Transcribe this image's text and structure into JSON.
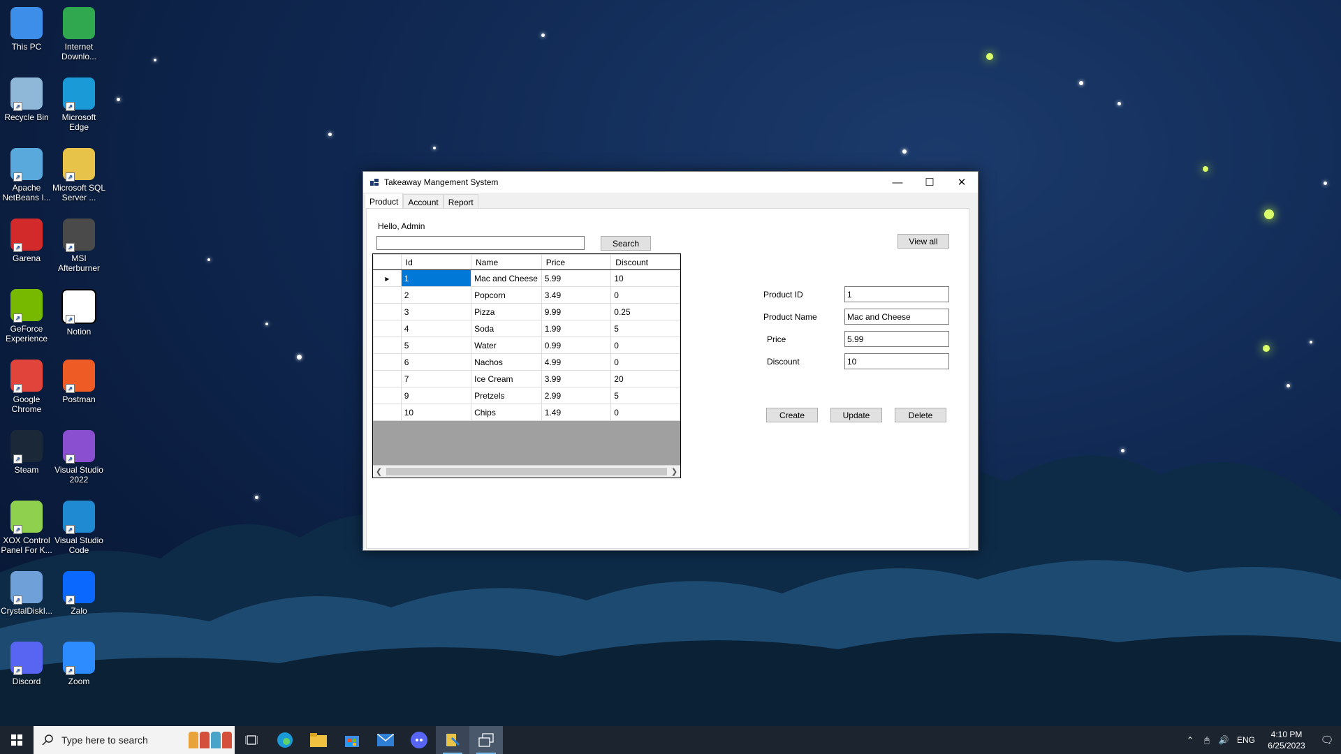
{
  "desktop": {
    "icons": [
      {
        "label": "This PC",
        "name": "this-pc-icon",
        "color": "#3d8ee8"
      },
      {
        "label": "Internet Downlo...",
        "name": "internet-download-manager-icon",
        "color": "#2fa84f"
      },
      {
        "label": "Recycle Bin",
        "name": "recycle-bin-icon",
        "color": "#8eb7d8"
      },
      {
        "label": "Microsoft Edge",
        "name": "edge-icon",
        "color": "#1a9bd7"
      },
      {
        "label": "Apache NetBeans I...",
        "name": "netbeans-icon",
        "color": "#5aa9dd"
      },
      {
        "label": "Microsoft SQL Server ...",
        "name": "sql-server-icon",
        "color": "#e8c34a"
      },
      {
        "label": "Garena",
        "name": "garena-icon",
        "color": "#d22a2a"
      },
      {
        "label": "MSI Afterburner",
        "name": "msi-afterburner-icon",
        "color": "#4a4a4a"
      },
      {
        "label": "GeForce Experience",
        "name": "geforce-icon",
        "color": "#76b900"
      },
      {
        "label": "Notion",
        "name": "notion-icon",
        "color": "#ffffff"
      },
      {
        "label": "Google Chrome",
        "name": "chrome-icon",
        "color": "#e0443a"
      },
      {
        "label": "Postman",
        "name": "postman-icon",
        "color": "#ef5b25"
      },
      {
        "label": "Steam",
        "name": "steam-icon",
        "color": "#1b2838"
      },
      {
        "label": "Visual Studio 2022",
        "name": "visual-studio-icon",
        "color": "#8a4fd0"
      },
      {
        "label": "XOX Control Panel For K...",
        "name": "xox-control-panel-icon",
        "color": "#8fd14f"
      },
      {
        "label": "Visual Studio Code",
        "name": "vscode-icon",
        "color": "#1f8ad2"
      },
      {
        "label": "CrystalDiskI...",
        "name": "crystaldiskinfo-icon",
        "color": "#6fa0d8"
      },
      {
        "label": "Zalo",
        "name": "zalo-icon",
        "color": "#0a68fe"
      },
      {
        "label": "Discord",
        "name": "discord-icon",
        "color": "#5865f2"
      },
      {
        "label": "Zoom",
        "name": "zoom-icon",
        "color": "#2d8cff"
      }
    ]
  },
  "window": {
    "title": "Takeaway Mangement System",
    "tabs": [
      "Product",
      "Account",
      "Report"
    ],
    "greeting": "Hello, Admin",
    "search": {
      "value": "",
      "button": "Search"
    },
    "view_all": "View all",
    "grid": {
      "columns": [
        "Id",
        "Name",
        "Price",
        "Discount"
      ],
      "rows": [
        [
          "1",
          "Mac and Cheese",
          "5.99",
          "10"
        ],
        [
          "2",
          "Popcorn",
          "3.49",
          "0"
        ],
        [
          "3",
          "Pizza",
          "9.99",
          "0.25"
        ],
        [
          "4",
          "Soda",
          "1.99",
          "5"
        ],
        [
          "5",
          "Water",
          "0.99",
          "0"
        ],
        [
          "6",
          "Nachos",
          "4.99",
          "0"
        ],
        [
          "7",
          "Ice Cream",
          "3.99",
          "20"
        ],
        [
          "9",
          "Pretzels",
          "2.99",
          "5"
        ],
        [
          "10",
          "Chips",
          "1.49",
          "0"
        ]
      ]
    },
    "form": {
      "product_id_label": "Product ID",
      "product_id_value": "1",
      "product_name_label": "Product Name",
      "product_name_value": "Mac and Cheese",
      "price_label": "Price",
      "price_value": "5.99",
      "discount_label": "Discount",
      "discount_value": "10"
    },
    "buttons": {
      "create": "Create",
      "update": "Update",
      "delete": "Delete"
    }
  },
  "taskbar": {
    "search_placeholder": "Type here to search",
    "language": "ENG",
    "time": "4:10 PM",
    "date": "6/25/2023"
  }
}
